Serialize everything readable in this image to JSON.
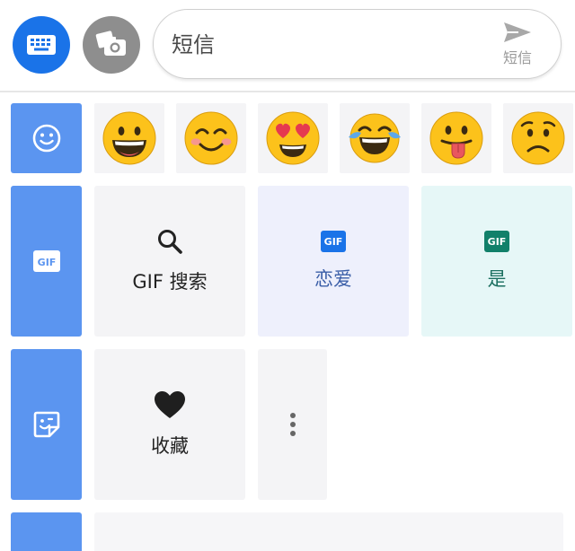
{
  "compose": {
    "placeholder": "短信",
    "send_label": "短信"
  },
  "emojis": [
    {
      "icon": "grinning-face-icon",
      "glyph": "😀"
    },
    {
      "icon": "smiling-face-icon",
      "glyph": "😊"
    },
    {
      "icon": "heart-eyes-face-icon",
      "glyph": "😍"
    },
    {
      "icon": "tears-of-joy-face-icon",
      "glyph": "😂"
    },
    {
      "icon": "tongue-out-face-icon",
      "glyph": "😛"
    },
    {
      "icon": "worried-face-icon",
      "glyph": "😟"
    }
  ],
  "gif_section": {
    "search_label": "GIF 搜索",
    "cards": [
      {
        "badge": "GIF",
        "label": "恋爱",
        "color": "#1a73e8",
        "label_color": "#3b5fa8",
        "bg": "#eef0fc"
      },
      {
        "badge": "GIF",
        "label": "是",
        "color": "#11806a",
        "label_color": "#1b6f60",
        "bg": "#e6f7f7"
      }
    ]
  },
  "sticker_section": {
    "favorites_label": "收藏"
  },
  "colors": {
    "accent": "#1a73e8",
    "rail": "#5b95f0"
  }
}
